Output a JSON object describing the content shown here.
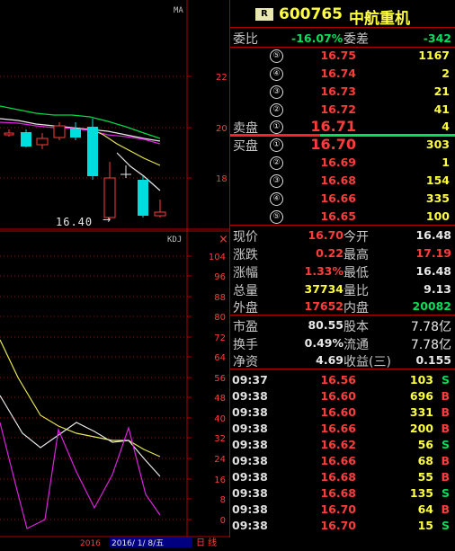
{
  "kline": {
    "ma_label": "MA",
    "y_ticks": [
      "22",
      "20",
      "18"
    ],
    "low_marker": "16.40",
    "low_arrow": "→"
  },
  "kdj": {
    "label": "KDJ",
    "y_ticks": [
      "104",
      "96",
      "88",
      "80",
      "72",
      "64",
      "56",
      "48",
      "40",
      "32",
      "24",
      "16",
      "8",
      "0"
    ],
    "close_icon": "×"
  },
  "bottom_bar": {
    "year_label": "2016",
    "date_label": "2016/ 1/ 8/五",
    "period_label": "日 线"
  },
  "header": {
    "badge": "R",
    "code": "600765",
    "name": "中航重机"
  },
  "weibi": {
    "label1": "委比",
    "value1": "-16.07%",
    "label2": "委差",
    "value2": "-342"
  },
  "sell": {
    "label": "卖盘",
    "rows": [
      {
        "idx": "⑤",
        "price": "16.75",
        "vol": "1167"
      },
      {
        "idx": "④",
        "price": "16.74",
        "vol": "2"
      },
      {
        "idx": "③",
        "price": "16.73",
        "vol": "21"
      },
      {
        "idx": "②",
        "price": "16.72",
        "vol": "41"
      },
      {
        "idx": "①",
        "price": "16.71",
        "vol": "4"
      }
    ]
  },
  "buy": {
    "label": "买盘",
    "rows": [
      {
        "idx": "①",
        "price": "16.70",
        "vol": "303"
      },
      {
        "idx": "②",
        "price": "16.69",
        "vol": "1"
      },
      {
        "idx": "③",
        "price": "16.68",
        "vol": "154"
      },
      {
        "idx": "④",
        "price": "16.66",
        "vol": "335"
      },
      {
        "idx": "⑤",
        "price": "16.65",
        "vol": "100"
      }
    ]
  },
  "quote": [
    {
      "k1": "现价",
      "v1": "16.70",
      "c1": "red",
      "k2": "今开",
      "v2": "16.48",
      "c2": "white"
    },
    {
      "k1": "涨跌",
      "v1": "0.22",
      "c1": "red",
      "k2": "最高",
      "v2": "17.19",
      "c2": "red"
    },
    {
      "k1": "涨幅",
      "v1": "1.33%",
      "c1": "red",
      "k2": "最低",
      "v2": "16.48",
      "c2": "white"
    },
    {
      "k1": "总量",
      "v1": "37734",
      "c1": "yellow",
      "k2": "量比",
      "v2": "9.13",
      "c2": "white"
    },
    {
      "k1": "外盘",
      "v1": "17652",
      "c1": "red",
      "k2": "内盘",
      "v2": "20082",
      "c2": "green"
    }
  ],
  "fund": [
    {
      "k1": "市盈",
      "v1": "80.55",
      "k2": "股本",
      "v2": "7.78亿"
    },
    {
      "k1": "换手",
      "v1": "0.49%",
      "k2": "流通",
      "v2": "7.78亿"
    },
    {
      "k1": "净资",
      "v1": "4.69",
      "k2": "收益(三)",
      "v2": "0.155"
    }
  ],
  "ticks": [
    {
      "time": "09:37",
      "price": "16.56",
      "vol": "103",
      "side": "S"
    },
    {
      "time": "09:38",
      "price": "16.60",
      "vol": "696",
      "side": "B"
    },
    {
      "time": "09:38",
      "price": "16.60",
      "vol": "331",
      "side": "B"
    },
    {
      "time": "09:38",
      "price": "16.66",
      "vol": "200",
      "side": "B"
    },
    {
      "time": "09:38",
      "price": "16.62",
      "vol": "56",
      "side": "S"
    },
    {
      "time": "09:38",
      "price": "16.66",
      "vol": "68",
      "side": "B"
    },
    {
      "time": "09:38",
      "price": "16.68",
      "vol": "55",
      "side": "B"
    },
    {
      "time": "09:38",
      "price": "16.68",
      "vol": "135",
      "side": "S"
    },
    {
      "time": "09:38",
      "price": "16.70",
      "vol": "64",
      "side": "B"
    },
    {
      "time": "09:38",
      "price": "16.70",
      "vol": "15",
      "side": "S"
    }
  ],
  "colors": {
    "up": "#ff3c3c",
    "down": "#00e05a",
    "vol": "#ffff3c",
    "grid": "#8a1010"
  }
}
